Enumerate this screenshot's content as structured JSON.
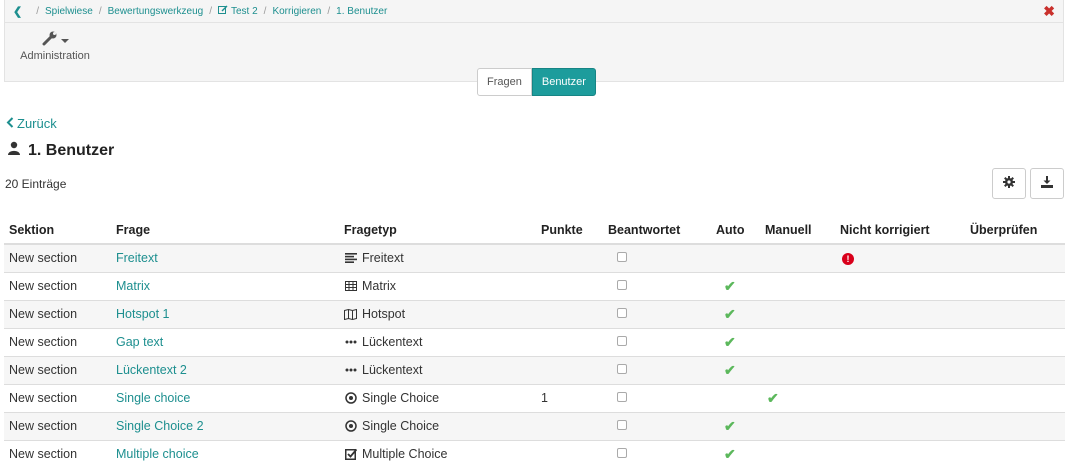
{
  "breadcrumb": {
    "items": [
      "Spielwiese",
      "Bewertungswerkzeug",
      "Test 2",
      "Korrigieren",
      "1. Benutzer"
    ],
    "separator": "/"
  },
  "toolbar": {
    "admin_label": "Administration",
    "admin_icon": "wrench-icon",
    "close_icon": "close-icon"
  },
  "segments": [
    {
      "label": "Fragen",
      "active": false
    },
    {
      "label": "Benutzer",
      "active": true
    }
  ],
  "back_label": "Zurück",
  "page_title": "1. Benutzer",
  "entries_label": "20 Einträge",
  "table": {
    "columns": [
      "Sektion",
      "Frage",
      "Fragetyp",
      "Punkte",
      "Beantwortet",
      "Auto",
      "Manuell",
      "Nicht korrigiert",
      "Überprüfen"
    ],
    "rows": [
      {
        "section": "New section",
        "question": "Freitext",
        "type": "Freitext",
        "type_icon": "align-left-icon",
        "points": "",
        "answered": false,
        "auto": false,
        "manual": false,
        "not_corrected": true
      },
      {
        "section": "New section",
        "question": "Matrix",
        "type": "Matrix",
        "type_icon": "table-icon",
        "points": "",
        "answered": false,
        "auto": true,
        "manual": false,
        "not_corrected": false
      },
      {
        "section": "New section",
        "question": "Hotspot 1",
        "type": "Hotspot",
        "type_icon": "map-icon",
        "points": "",
        "answered": false,
        "auto": true,
        "manual": false,
        "not_corrected": false
      },
      {
        "section": "New section",
        "question": "Gap text",
        "type": "Lückentext",
        "type_icon": "ellipsis-icon",
        "points": "",
        "answered": false,
        "auto": true,
        "manual": false,
        "not_corrected": false
      },
      {
        "section": "New section",
        "question": "Lückentext 2",
        "type": "Lückentext",
        "type_icon": "ellipsis-icon",
        "points": "",
        "answered": false,
        "auto": true,
        "manual": false,
        "not_corrected": false
      },
      {
        "section": "New section",
        "question": "Single choice",
        "type": "Single Choice",
        "type_icon": "radio-dot-icon",
        "points": "1",
        "answered": false,
        "auto": false,
        "manual": true,
        "not_corrected": false
      },
      {
        "section": "New section",
        "question": "Single Choice 2",
        "type": "Single Choice",
        "type_icon": "radio-dot-icon",
        "points": "",
        "answered": false,
        "auto": true,
        "manual": false,
        "not_corrected": false
      },
      {
        "section": "New section",
        "question": "Multiple choice",
        "type": "Multiple Choice",
        "type_icon": "check-square-icon",
        "points": "",
        "answered": false,
        "auto": true,
        "manual": false,
        "not_corrected": false
      }
    ]
  },
  "colors": {
    "accent": "#1d9c9c",
    "link": "#1d8f8f",
    "success": "#5cb85c",
    "danger": "#d9001b"
  }
}
